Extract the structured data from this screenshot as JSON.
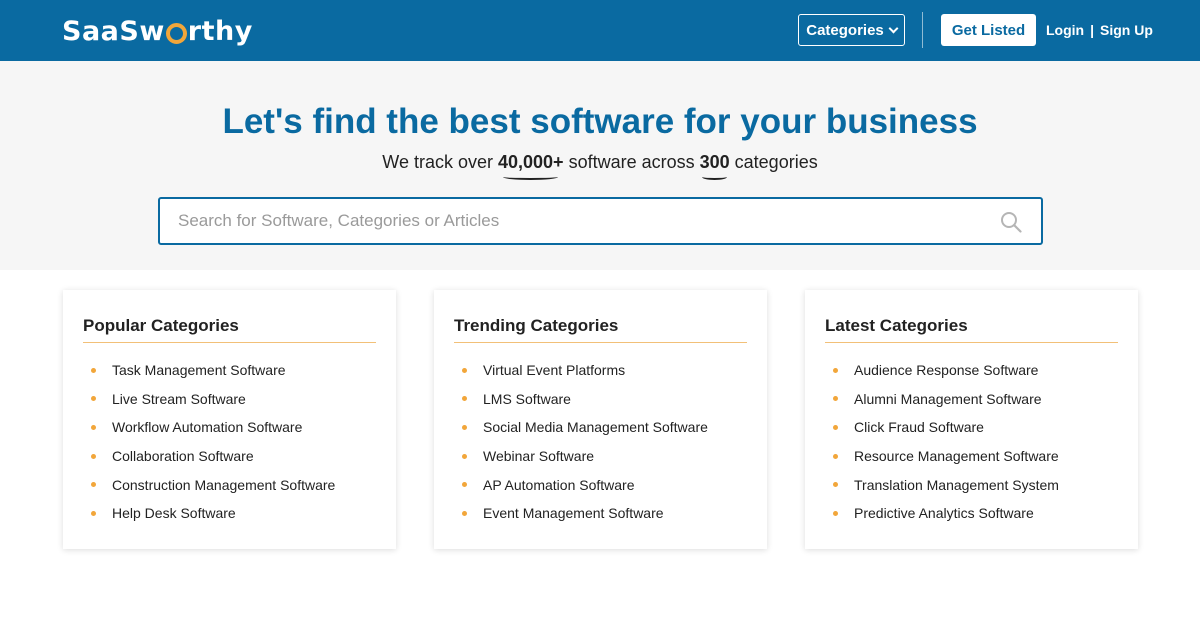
{
  "header": {
    "logo_text": "SaaSworthy",
    "categories_button": "Categories",
    "get_listed_button": "Get Listed",
    "login_link": "Login",
    "separator": "|",
    "signup_link": "Sign Up"
  },
  "hero": {
    "title": "Let's find the best software for your business",
    "subtitle_prefix": "We track over ",
    "software_count": "40,000+",
    "subtitle_middle": " software across ",
    "category_count": "300",
    "subtitle_suffix": " categories",
    "search_placeholder": "Search for Software, Categories or Articles",
    "search_value": ""
  },
  "colors": {
    "brand_blue": "#0a6aa1",
    "accent_orange": "#f2a63a",
    "hero_background": "#f6f6f6"
  },
  "icons": {
    "search": "search-icon",
    "dropdown": "chevron-down-icon",
    "bullet": "bullet-dot-icon"
  },
  "cards": [
    {
      "title": "Popular Categories",
      "items": [
        "Task Management Software",
        "Live Stream Software",
        "Workflow Automation Software",
        "Collaboration Software",
        "Construction Management Software",
        "Help Desk Software"
      ]
    },
    {
      "title": "Trending Categories",
      "items": [
        "Virtual Event Platforms",
        "LMS Software",
        "Social Media Management Software",
        "Webinar Software",
        "AP Automation Software",
        "Event Management Software"
      ]
    },
    {
      "title": "Latest Categories",
      "items": [
        "Audience Response Software",
        "Alumni Management Software",
        "Click Fraud Software",
        "Resource Management Software",
        "Translation Management System",
        "Predictive Analytics Software"
      ]
    }
  ]
}
